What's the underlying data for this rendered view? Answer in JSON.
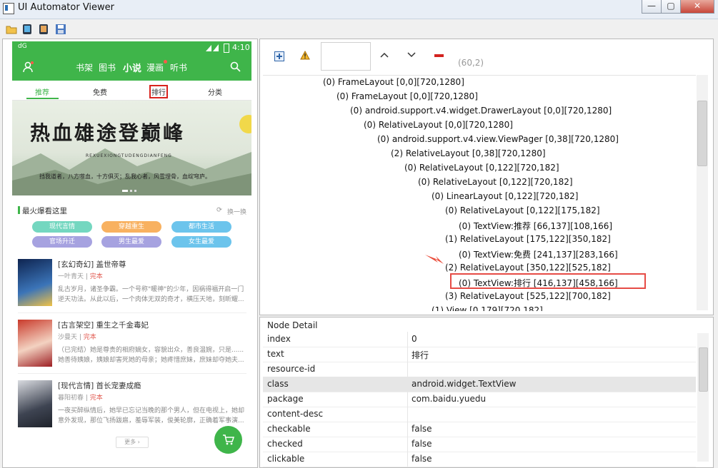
{
  "window": {
    "title": "UI Automator Viewer"
  },
  "titlebar_buttons": [
    "—",
    "▢",
    "✕"
  ],
  "phone": {
    "status": {
      "left": "dG",
      "time": "4:10"
    },
    "nav": [
      "书架",
      "图书",
      "小说",
      "漫画",
      "听书"
    ],
    "tabs": [
      "推荐",
      "免费",
      "排行",
      "分类"
    ],
    "banner": {
      "title": "热血雄途登巅峰",
      "pinyin": "REXUEXIONGTUDENGDIANFENG",
      "slogan": "挡我道者，八方噬血，十方俱灭；乱我心者，风雪埋骨，血绽穹庐。"
    },
    "section": {
      "title": "最火爆看这里",
      "refresh": "换一换"
    },
    "tags": [
      "现代言情",
      "穿越重生",
      "都市生活",
      "官场升迁",
      "男生最爱",
      "女生最爱"
    ],
    "books": [
      {
        "title": "[玄幻奇幻]  盖世帝尊",
        "author": "一叶青天",
        "status": "完本",
        "desc": "乱古岁月，诸圣争霸。一个号称\"暖神\"的少年，因祸得福开启一门逆天功法。从此以后，一个肉体无双的奇才，横压天地，刻昕耀..."
      },
      {
        "title": "[古言架空]  重生之千金毒妃",
        "author": "沙曼天",
        "status": "完本",
        "desc": "（已完结）她是尊贵的相府嫡女，容貌出众，善良温婉，只是......她善待姨娘，姨娘却害死她的母亲；她疼惜庶妹，庶妹却夺她夫..."
      },
      {
        "title": "[现代言情]  首长宠妻成瘾",
        "author": "暮阳初春",
        "status": "完本",
        "desc": "一夜买醉纵情后，她早已忘记当晚的那个男人，但在电视上，她却意外发现，那位飞扬跋扈，羞辱军装，俊美轮廓，正确着军事演..."
      }
    ],
    "more": "更多"
  },
  "toolbar2": {
    "coords": "(60,2)"
  },
  "tree": [
    {
      "text": "(0) FrameLayout [0,0][720,1280]",
      "level": 0
    },
    {
      "text": "(0) FrameLayout [0,0][720,1280]",
      "level": 1
    },
    {
      "text": "(0) android.support.v4.widget.DrawerLayout [0,0][720,1280]",
      "level": 2
    },
    {
      "text": "(0) RelativeLayout [0,0][720,1280]",
      "level": 3
    },
    {
      "text": "(0) android.support.v4.view.ViewPager [0,38][720,1280]",
      "level": 4
    },
    {
      "text": "(2) RelativeLayout [0,38][720,1280]",
      "level": 5
    },
    {
      "text": "(0) RelativeLayout [0,122][720,182]",
      "level": 6
    },
    {
      "text": "(0) RelativeLayout [0,122][720,182]",
      "level": 7
    },
    {
      "text": "(0) LinearLayout [0,122][720,182]",
      "level": 8
    },
    {
      "text": "(0) RelativeLayout [0,122][175,182]",
      "level": 9
    },
    {
      "text": "(0) TextView:推荐 [66,137][108,166]",
      "level": 10
    },
    {
      "text": "(1) RelativeLayout [175,122][350,182]",
      "level": 9
    },
    {
      "text": "(0) TextView:免费 [241,137][283,166]",
      "level": 10
    },
    {
      "text": "(2) RelativeLayout [350,122][525,182]",
      "level": 9
    },
    {
      "text": "(0) TextView:排行 [416,137][458,166]",
      "level": 10,
      "selected": true
    },
    {
      "text": "(3) RelativeLayout [525,122][700,182]",
      "level": 9
    },
    {
      "text": "(1) View [0,179][720,182]",
      "level": 8
    }
  ],
  "detail": {
    "header": "Node Detail",
    "rows": [
      {
        "key": "index",
        "value": "0"
      },
      {
        "key": "text",
        "value": "排行"
      },
      {
        "key": "resource-id",
        "value": ""
      },
      {
        "key": "class",
        "value": "android.widget.TextView"
      },
      {
        "key": "package",
        "value": "com.baidu.yuedu"
      },
      {
        "key": "content-desc",
        "value": ""
      },
      {
        "key": "checkable",
        "value": "false"
      },
      {
        "key": "checked",
        "value": "false"
      },
      {
        "key": "clickable",
        "value": "false"
      }
    ]
  }
}
